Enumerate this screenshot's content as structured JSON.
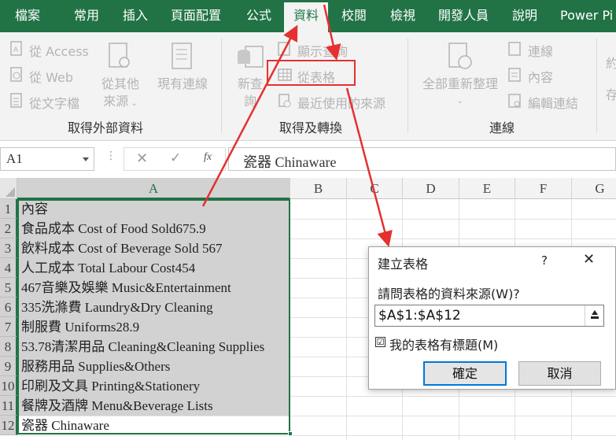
{
  "tabs": [
    {
      "label": "檔案"
    },
    {
      "label": "常用"
    },
    {
      "label": "插入"
    },
    {
      "label": "頁面配置"
    },
    {
      "label": "公式"
    },
    {
      "label": "資料"
    },
    {
      "label": "校閱"
    },
    {
      "label": "檢視"
    },
    {
      "label": "開發人員"
    },
    {
      "label": "說明"
    },
    {
      "label": "Power Pi"
    }
  ],
  "active_tab": "資料",
  "ribbon": {
    "external": {
      "access": "從 Access",
      "web": "從 Web",
      "text": "從文字檔",
      "other_line1": "從其他",
      "other_line2": "來源",
      "existing": "現有連線",
      "group": "取得外部資料"
    },
    "transform": {
      "new_query_line1": "新查",
      "new_query_line2": "詢",
      "show_queries": "顯示查詢",
      "from_table": "從表格",
      "recent_sources": "最近使用的來源",
      "group": "取得及轉換"
    },
    "connections": {
      "refresh_all": "全部重新整理",
      "connections": "連線",
      "properties": "內容",
      "edit_links": "編輯連結",
      "group": "連線"
    },
    "cutoff": {
      "line1": "約",
      "line2": "存"
    }
  },
  "formula_bar": {
    "name_box": "A1",
    "fx": "fx",
    "content": "瓷器 Chinaware"
  },
  "grid": {
    "columns": [
      "A",
      "B",
      "C",
      "D",
      "E",
      "F",
      "G"
    ],
    "rows": [
      "1",
      "2",
      "3",
      "4",
      "5",
      "6",
      "7",
      "8",
      "9",
      "10",
      "11",
      "12"
    ],
    "cells_a": [
      "內容",
      "食品成本 Cost of Food Sold675.9",
      "飲料成本 Cost of Beverage Sold 567",
      "人工成本 Total Labour Cost454",
      "467音樂及娛樂 Music&Entertainment",
      "335洗滌費 Laundry&Dry Cleaning",
      "制服費 Uniforms28.9",
      "53.78清潔用品 Cleaning&Cleaning Supplies",
      "服務用品 Supplies&Others",
      "印刷及文具 Printing&Stationery",
      "餐牌及酒牌 Menu&Beverage Lists",
      "瓷器 Chinaware"
    ]
  },
  "dialog": {
    "title": "建立表格",
    "help": "?",
    "close": "✕",
    "prompt": "請問表格的資料來源(W)?",
    "range": "$A$1:$A$12",
    "checkbox_checked": true,
    "checkbox_mark": "☑",
    "checkbox_label": "我的表格有標題(M)",
    "ok": "確定",
    "cancel": "取消"
  },
  "colors": {
    "excel_green": "#217346",
    "annotation_red": "#e53030",
    "ribbon_bg": "#f3f3f3",
    "selection_fill": "#d2d2d2"
  }
}
